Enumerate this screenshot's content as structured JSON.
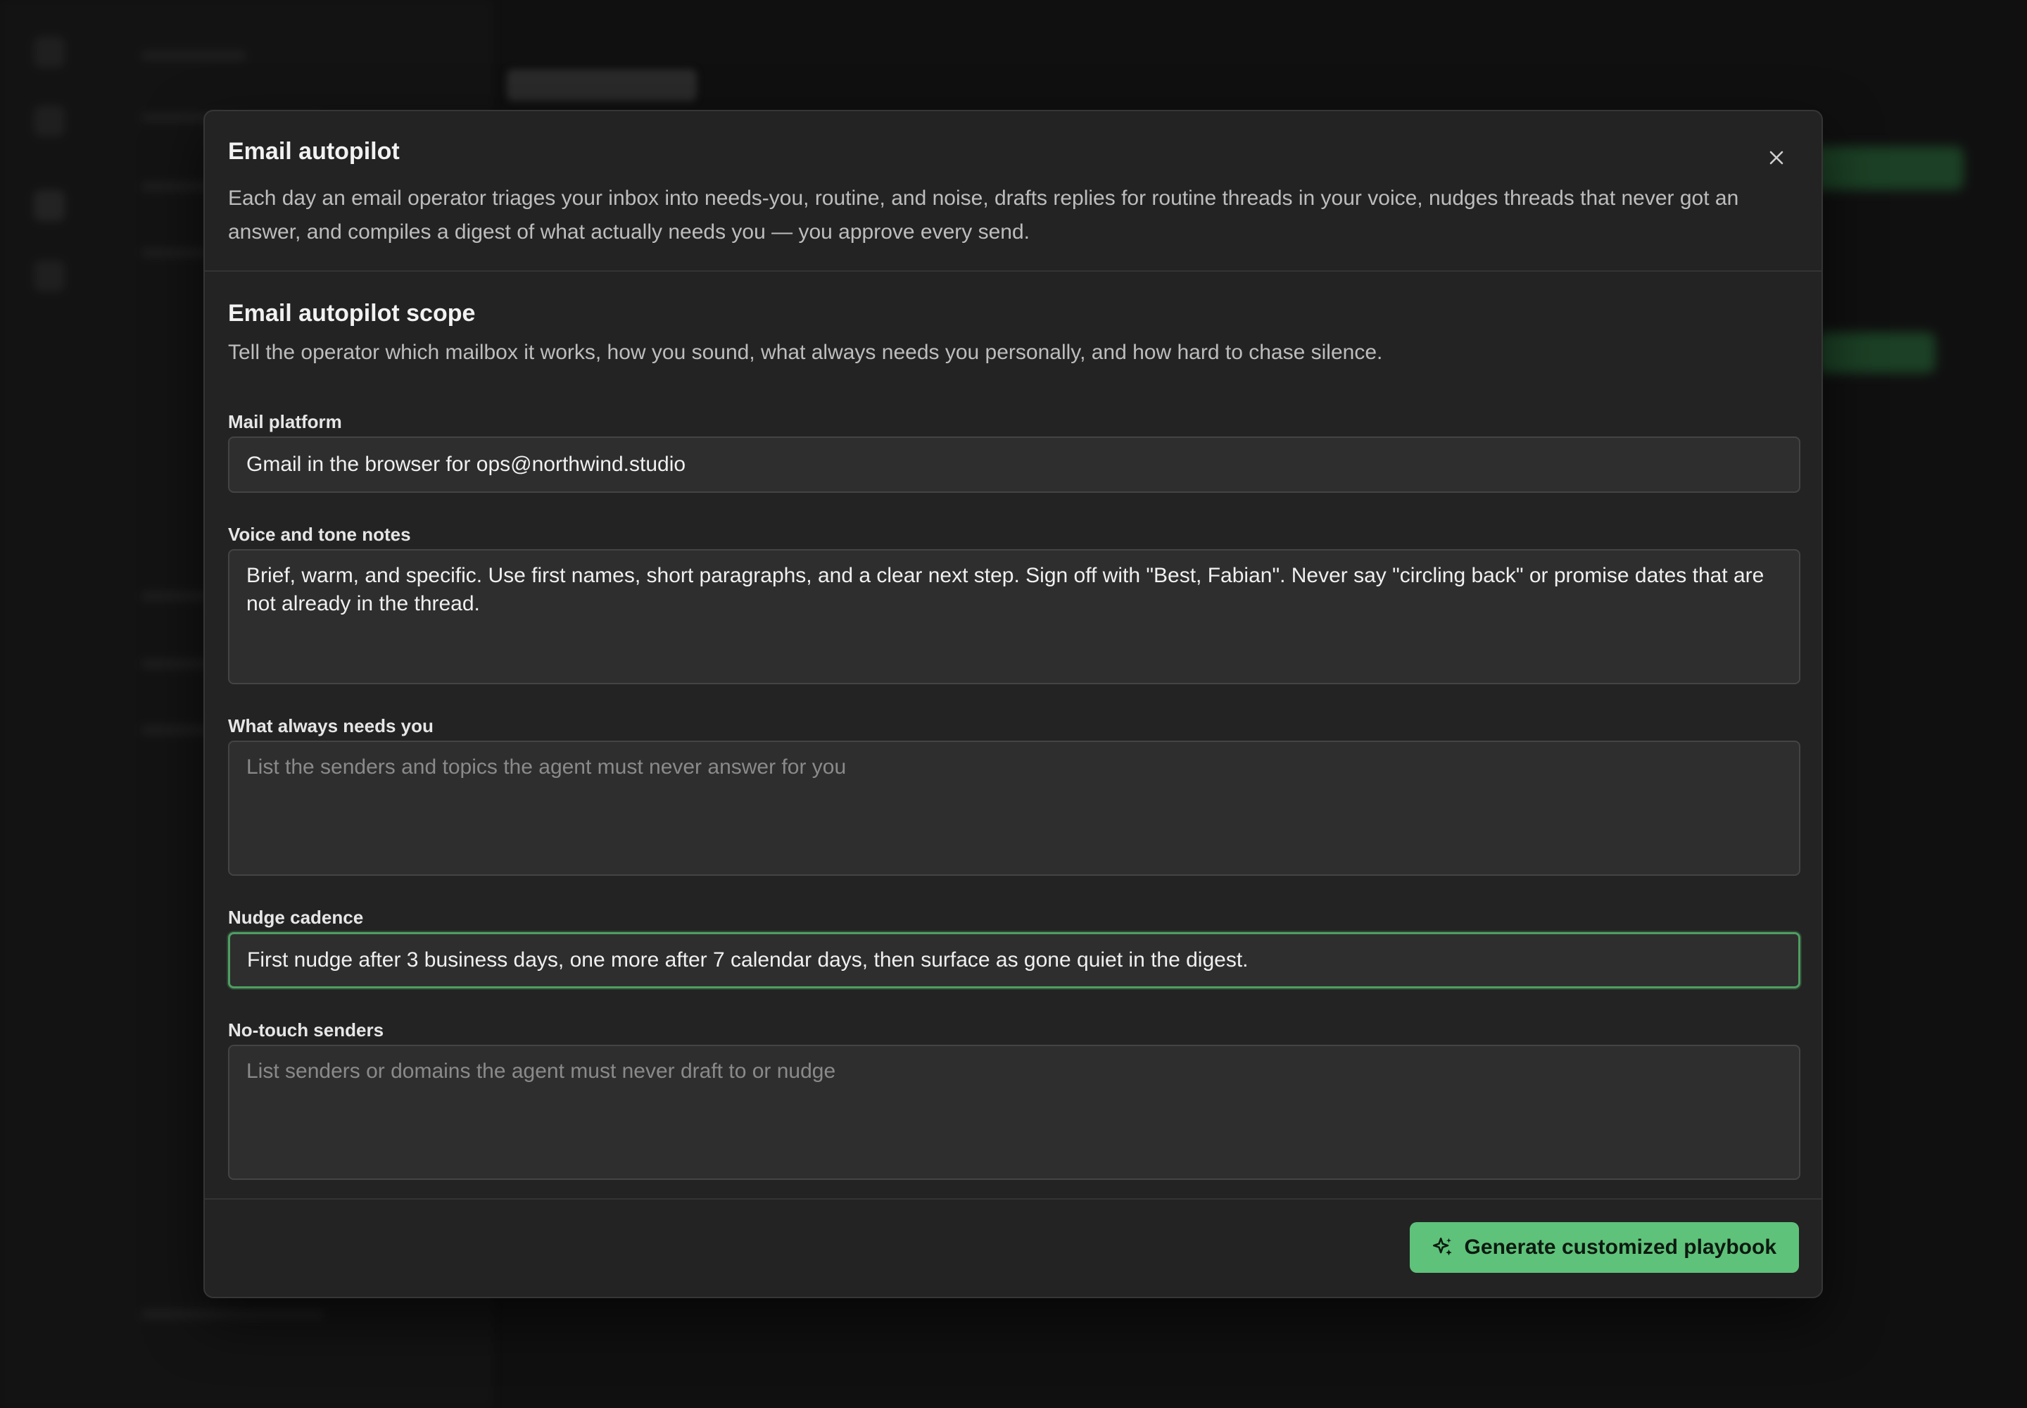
{
  "modal": {
    "title": "Email autopilot",
    "description": "Each day an email operator triages your inbox into needs-you, routine, and noise, drafts replies for routine threads in your voice, nudges threads that never got an answer, and compiles a digest of what actually needs you — you approve every send.",
    "close_icon": "close-icon"
  },
  "scope": {
    "title": "Email autopilot scope",
    "description": "Tell the operator which mailbox it works, how you sound, what always needs you personally, and how hard to chase silence."
  },
  "fields": {
    "mail_platform": {
      "label": "Mail platform",
      "value": "Gmail in the browser for ops@northwind.studio"
    },
    "voice_tone": {
      "label": "Voice and tone notes",
      "value": "Brief, warm, and specific. Use first names, short paragraphs, and a clear next step. Sign off with \"Best, Fabian\". Never say \"circling back\" or promise dates that are not already in the thread."
    },
    "always_needs_you": {
      "label": "What always needs you",
      "placeholder": "List the senders and topics the agent must never answer for you"
    },
    "nudge_cadence": {
      "label": "Nudge cadence",
      "value": "First nudge after 3 business days, one more after 7 calendar days, then surface as gone quiet in the digest."
    },
    "no_touch_senders": {
      "label": "No-touch senders",
      "placeholder": "List senders or domains the agent must never draft to or nudge"
    }
  },
  "footer": {
    "generate_label": "Generate customized playbook",
    "generate_icon": "sparkles-icon"
  },
  "colors": {
    "accent": "#5fc27a",
    "focus_border": "#4f9e62",
    "modal_bg": "#232323",
    "field_bg": "#2e2e2e"
  }
}
